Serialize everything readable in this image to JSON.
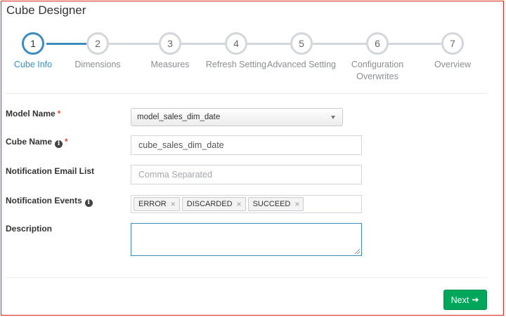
{
  "title": "Cube Designer",
  "steps": [
    {
      "number": "1",
      "label": "Cube Info",
      "label2": ""
    },
    {
      "number": "2",
      "label": "Dimensions",
      "label2": ""
    },
    {
      "number": "3",
      "label": "Measures",
      "label2": ""
    },
    {
      "number": "4",
      "label": "Refresh Setting",
      "label2": ""
    },
    {
      "number": "5",
      "label": "Advanced Setting",
      "label2": ""
    },
    {
      "number": "6",
      "label": "Configuration",
      "label2": "Overwrites"
    },
    {
      "number": "7",
      "label": "Overview",
      "label2": ""
    }
  ],
  "active_step": 1,
  "form": {
    "model_name": {
      "label": "Model Name",
      "required": "*",
      "value": "model_sales_dim_date"
    },
    "cube_name": {
      "label": "Cube Name",
      "required": "*",
      "value": "cube_sales_dim_date",
      "info_icon": "i"
    },
    "notification_email": {
      "label": "Notification Email List",
      "placeholder": "Comma Separated",
      "value": ""
    },
    "notification_events": {
      "label": "Notification Events",
      "info_icon": "i",
      "tags": [
        "ERROR",
        "DISCARDED",
        "SUCCEED"
      ],
      "remove_glyph": "×"
    },
    "description": {
      "label": "Description",
      "value": ""
    }
  },
  "next_button": {
    "label": "Next",
    "icon": "arrow-right-icon"
  },
  "colors": {
    "accent": "#3c8dbc",
    "success": "#00a65a",
    "required": "#dd4b39",
    "frame_border": "#e1251b"
  }
}
